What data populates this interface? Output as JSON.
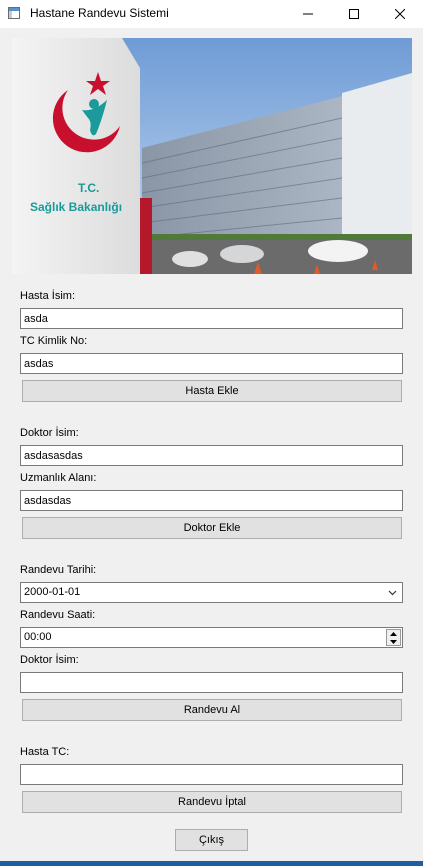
{
  "window": {
    "title": "Hastane Randevu Sistemi",
    "icon": "app-window-icon",
    "controls": [
      "minimize-icon",
      "maximize-icon",
      "close-icon"
    ]
  },
  "banner": {
    "logo_line1": "T.C.",
    "logo_line2": "Sağlık Bakanlığı",
    "brand_color": "#1a9a9a",
    "accent_color": "#c8102e"
  },
  "patient": {
    "name_label": "Hasta İsim:",
    "name_value": "asda",
    "tc_label": "TC Kimlik No:",
    "tc_value": "asdas",
    "add_button": "Hasta Ekle"
  },
  "doctor": {
    "name_label": "Doktor İsim:",
    "name_value": "asdasasdas",
    "specialty_label": "Uzmanlık Alanı:",
    "specialty_value": "asdasdas",
    "add_button": "Doktor Ekle"
  },
  "appointment": {
    "date_label": "Randevu Tarihi:",
    "date_value": "2000-01-01",
    "time_label": "Randevu Saati:",
    "time_value": "00:00",
    "doctor_label": "Doktor İsim:",
    "doctor_value": "",
    "take_button": "Randevu Al"
  },
  "cancel": {
    "tc_label": "Hasta TC:",
    "tc_value": "",
    "cancel_button": "Randevu İptal"
  },
  "exit_button": "Çıkış"
}
